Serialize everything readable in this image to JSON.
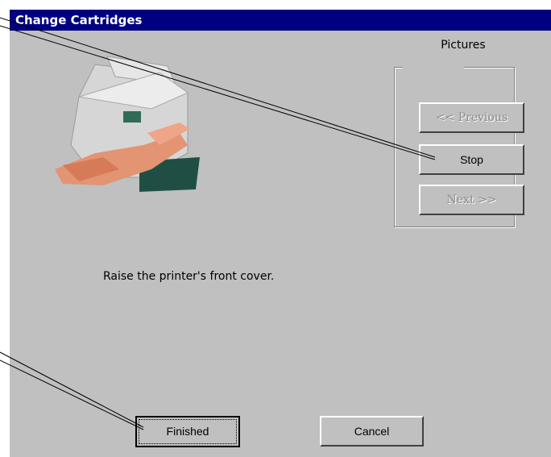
{
  "window": {
    "title": "Change Cartridges"
  },
  "pictures": {
    "label": "Pictures",
    "previous_label": "<< Previous",
    "stop_label": "Stop",
    "next_label": "Next >>"
  },
  "message": "Raise the printer's front cover.",
  "footer": {
    "finished_label": "Finished",
    "cancel_label": "Cancel"
  }
}
